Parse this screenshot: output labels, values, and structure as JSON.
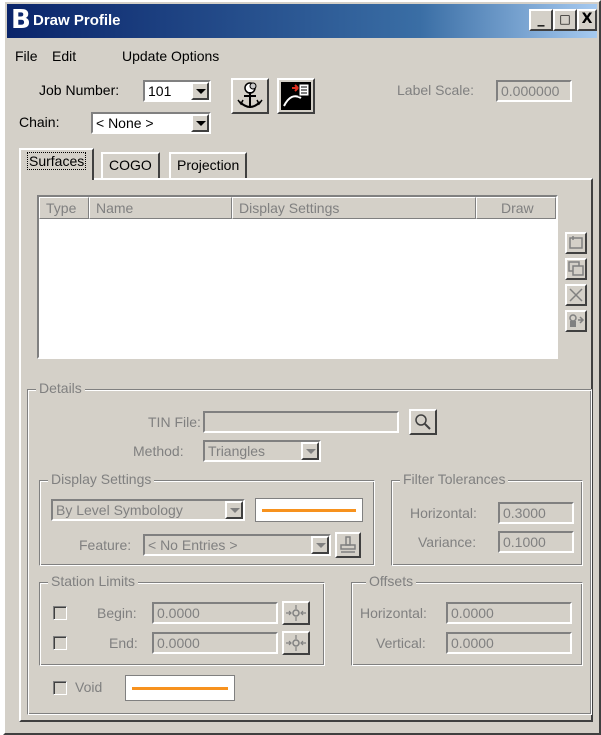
{
  "window": {
    "title": "Draw Profile",
    "title_logo": "B",
    "controls": {
      "minimize": "_",
      "maximize": "□",
      "close": "X"
    }
  },
  "menu": [
    "File",
    "Edit",
    "Update Options"
  ],
  "header": {
    "job_number_label": "Job Number:",
    "job_number_value": "101",
    "chain_label": "Chain:",
    "chain_value": "< None >",
    "label_scale_label": "Label Scale:",
    "label_scale_value": "0.000000",
    "icons": [
      "anchor-icon",
      "draw-profile-icon"
    ]
  },
  "tabs": [
    {
      "label": "Surfaces",
      "active": true
    },
    {
      "label": "COGO",
      "active": false
    },
    {
      "label": "Projection",
      "active": false
    }
  ],
  "surfaces_list": {
    "columns": [
      "Type",
      "Name",
      "Display Settings",
      "Draw"
    ],
    "rows": []
  },
  "side_buttons": [
    "add-icon",
    "copy-icon",
    "delete-icon",
    "edit-icon"
  ],
  "details": {
    "title": "Details",
    "tin_file_label": "TIN File:",
    "tin_file_value": "",
    "method_label": "Method:",
    "method_value": "Triangles"
  },
  "display_settings": {
    "title": "Display Settings",
    "symbology_value": "By Level Symbology",
    "feature_label": "Feature:",
    "feature_value": "< No Entries >",
    "line_color": "#f7921e"
  },
  "filter_tolerances": {
    "title": "Filter Tolerances",
    "horizontal_label": "Horizontal:",
    "horizontal_value": "0.3000",
    "variance_label": "Variance:",
    "variance_value": "0.1000"
  },
  "station_limits": {
    "title": "Station Limits",
    "begin_label": "Begin:",
    "begin_value": "0.0000",
    "end_label": "End:",
    "end_value": "0.0000",
    "begin_checked": false,
    "end_checked": false
  },
  "offsets": {
    "title": "Offsets",
    "horizontal_label": "Horizontal:",
    "horizontal_value": "0.0000",
    "vertical_label": "Vertical:",
    "vertical_value": "0.0000"
  },
  "void": {
    "label": "Void",
    "checked": false,
    "line_color": "#f7921e"
  },
  "colors": {
    "dialog_face": "#d4d0c8",
    "titlebar_start": "#0a246a",
    "disabled_text": "#808080",
    "accent_orange": "#f7921e"
  }
}
